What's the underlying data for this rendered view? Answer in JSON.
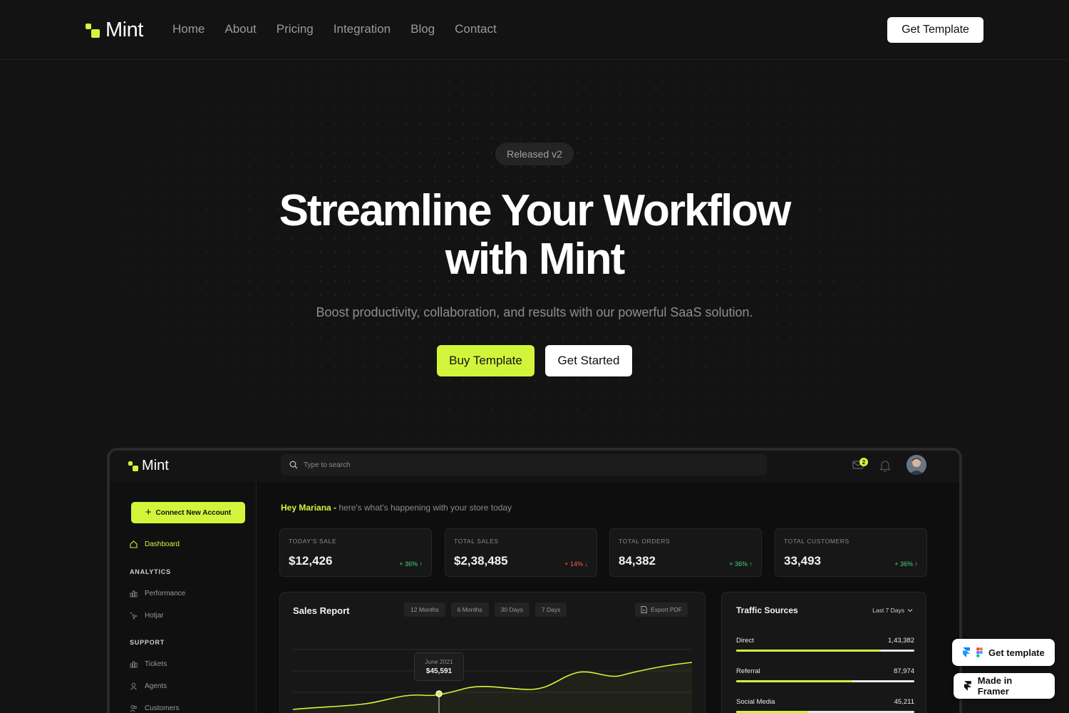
{
  "nav": {
    "brand": "Mint",
    "links": [
      "Home",
      "About",
      "Pricing",
      "Integration",
      "Blog",
      "Contact"
    ],
    "cta": "Get Template"
  },
  "hero": {
    "badge": "Released v2",
    "title_line1": "Streamline Your Workflow",
    "title_line2": "with Mint",
    "subtitle": "Boost productivity, collaboration, and results with our powerful SaaS solution.",
    "primary_button": "Buy Template",
    "secondary_button": "Get Started"
  },
  "dashboard": {
    "brand": "Mint",
    "search_placeholder": "Type to search",
    "mail_count": "2",
    "connect_button": "Connect New Account",
    "sidebar": {
      "dashboard": "Dashboard",
      "analytics_heading": "ANALYTICS",
      "performance": "Performance",
      "hotjar": "Hotjar",
      "support_heading": "SUPPORT",
      "tickets": "Tickets",
      "agents": "Agents",
      "customers": "Customers"
    },
    "greeting_name": "Hey Mariana -",
    "greeting_rest": "here's what's happening with your store today",
    "kpis": [
      {
        "label": "TODAY'S SALE",
        "value": "$12,426",
        "delta": "+ 36% ↑",
        "trend": "up"
      },
      {
        "label": "TOTAL SALES",
        "value": "$2,38,485",
        "delta": "+ 14% ↓",
        "trend": "down"
      },
      {
        "label": "TOTAL ORDERS",
        "value": "84,382",
        "delta": "+ 36% ↑",
        "trend": "up"
      },
      {
        "label": "TOTAL CUSTOMERS",
        "value": "33,493",
        "delta": "+ 36% ↑",
        "trend": "up"
      }
    ],
    "sales_report": {
      "title": "Sales Report",
      "ranges": [
        "12 Months",
        "6 Months",
        "30 Days",
        "7 Days"
      ],
      "export": "Export PDF",
      "tooltip_date": "June 2021",
      "tooltip_value": "$45,591"
    },
    "traffic": {
      "title": "Traffic Sources",
      "range": "Last 7 Days",
      "sources": [
        {
          "name": "Direct",
          "value": "1,43,382",
          "fill": 0.81
        },
        {
          "name": "Referral",
          "value": "87,974",
          "fill": 0.65
        },
        {
          "name": "Social Media",
          "value": "45,211",
          "fill": 0.4
        }
      ]
    }
  },
  "badges": {
    "get_template": "Get template",
    "made_in_framer": "Made in Framer"
  },
  "colors": {
    "accent": "#d2f53c",
    "background": "#131313",
    "up": "#4fd37a",
    "down": "#ff5b5b"
  }
}
